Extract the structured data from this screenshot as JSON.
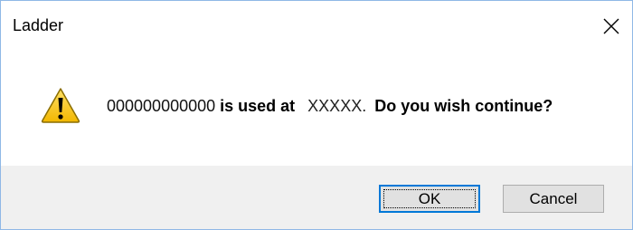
{
  "window": {
    "title": "Ladder",
    "close_symbol": "✕"
  },
  "message": {
    "code": "000000000000",
    "used_at_text": " is used at",
    "location": "XXXXX.",
    "question": "Do you wish continue?",
    "icon": "warning-icon"
  },
  "buttons": {
    "ok_label": "OK",
    "cancel_label": "Cancel"
  },
  "colors": {
    "warning_fill": "#f5c800",
    "accent": "#0078d7",
    "footer_bg": "#f0f0f0"
  }
}
